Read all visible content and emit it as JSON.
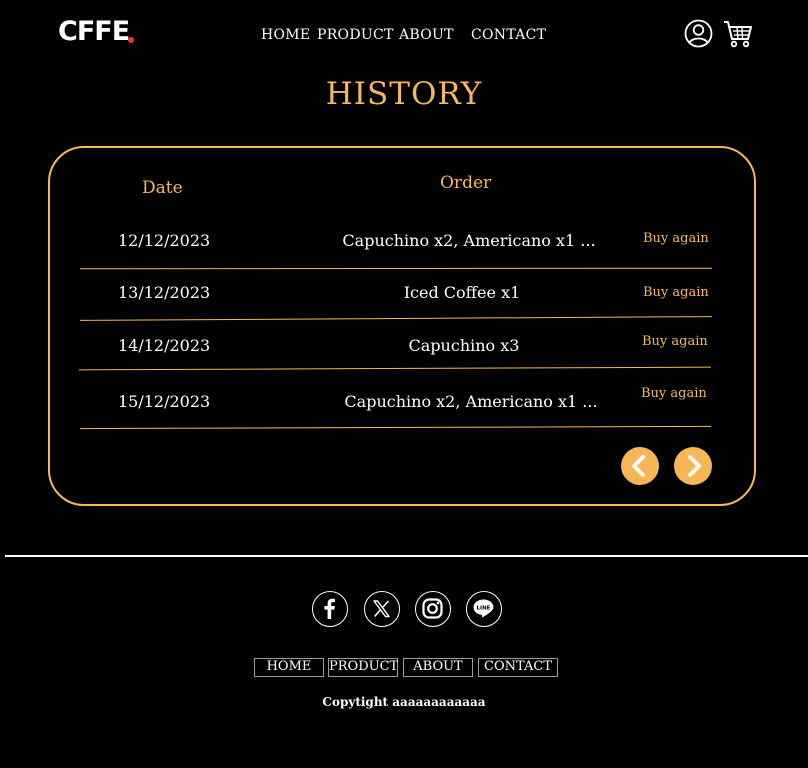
{
  "brand": {
    "logo": "CFFE"
  },
  "header": {
    "nav": [
      "HOME",
      "PRODUCT",
      "ABOUT",
      "CONTACT"
    ],
    "icons": [
      "user-icon",
      "cart-icon"
    ]
  },
  "page": {
    "title": "HISTORY"
  },
  "history": {
    "columns": {
      "date": "Date",
      "order": "Order"
    },
    "rows": [
      {
        "date": "12/12/2023",
        "order": "Capuchino x2, Americano x1 ...",
        "action": "Buy again"
      },
      {
        "date": "13/12/2023",
        "order": "Iced Coffee x1",
        "action": "Buy again"
      },
      {
        "date": "14/12/2023",
        "order": "Capuchino x3",
        "action": "Buy again"
      },
      {
        "date": "15/12/2023",
        "order": "Capuchino x2, Americano x1 ...",
        "action": "Buy again"
      }
    ],
    "pager": [
      "chevron-left-icon",
      "chevron-right-icon"
    ]
  },
  "footer": {
    "social": [
      "facebook-icon",
      "x-icon",
      "instagram-icon",
      "line-icon"
    ],
    "nav": [
      "HOME",
      "PRODUCT",
      "ABOUT",
      "CONTACT"
    ],
    "copyright": "Copytight aaaaaaaaaaaa"
  },
  "colors": {
    "accent": "#f6b85b",
    "button": "#f9b655",
    "logo_dot": "#e53935",
    "background": "#000000"
  }
}
